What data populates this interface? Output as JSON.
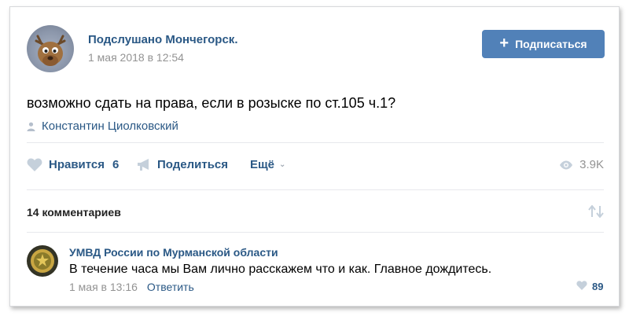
{
  "post": {
    "author": "Подслушано Мончегорск.",
    "date": "1 мая 2018 в 12:54",
    "subscribe_label": "Подписаться",
    "text": "возможно сдать на права, если в розыске по ст.105 ч.1?",
    "signer": "Константин Циолковский"
  },
  "actions": {
    "like_label": "Нравится",
    "like_count": "6",
    "share_label": "Поделиться",
    "more_label": "Ещё",
    "views": "3.9K"
  },
  "comments": {
    "header": "14 комментариев",
    "items": [
      {
        "author": "УМВД России по Мурманской области",
        "text": "В течение часа мы Вам лично расскажем что и как. Главное дождитесь.",
        "date": "1 мая в 13:16",
        "reply_label": "Ответить",
        "likes": "89"
      }
    ]
  },
  "colors": {
    "link": "#2a5885",
    "button": "#5181b8",
    "meta": "#939393",
    "icon": "#c5d0db"
  },
  "icons": [
    "avatar-moose",
    "plus-icon",
    "person-icon",
    "heart-icon",
    "megaphone-icon",
    "chevron-down-icon",
    "eye-icon",
    "sort-icon",
    "police-emblem-avatar"
  ]
}
